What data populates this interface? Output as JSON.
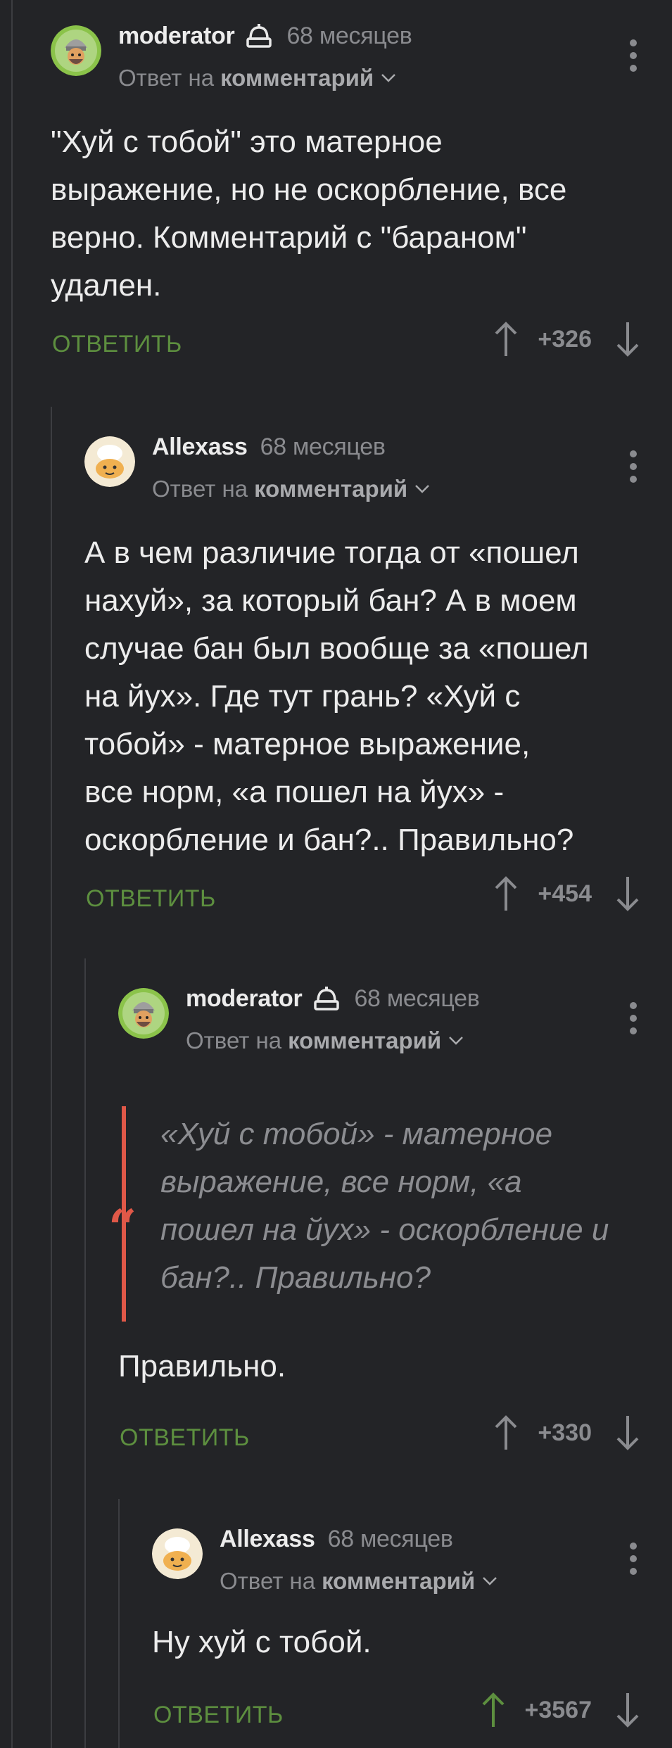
{
  "comments": [
    {
      "author": "moderator",
      "time": "68 месяцев",
      "reply_prefix": "Ответ на",
      "reply_target": "комментарий",
      "text_lines": [
        "\"Хуй с тобой\" это матерное",
        "выражение, но не оскорбление, все",
        "верно. Комментарий с \"бараном\"",
        "удален."
      ],
      "reply_label": "ОТВЕТИТЬ",
      "score": "+326"
    },
    {
      "author": "Allexass",
      "time": "68 месяцев",
      "reply_prefix": "Ответ на",
      "reply_target": "комментарий",
      "text_lines": [
        "А в чем различие тогда от «пошел",
        "нахуй», за который бан? А в моем",
        "случае бан был вообще за «пошел",
        "на йух». Где тут грань? «Хуй с",
        "тобой» - матерное выражение,",
        "все норм, «а пошел на йух» -",
        "оскорбление и бан?.. Правильно?"
      ],
      "reply_label": "ОТВЕТИТЬ",
      "score": "+454"
    },
    {
      "author": "moderator",
      "time": "68 месяцев",
      "reply_prefix": "Ответ на",
      "reply_target": "комментарий",
      "quote_lines": [
        "«Хуй с тобой» - матерное",
        "выражение, все норм, «а",
        "пошел на йух» - оскорбление и",
        "бан?.. Правильно?"
      ],
      "text_lines": [
        "Правильно."
      ],
      "reply_label": "ОТВЕТИТЬ",
      "score": "+330"
    },
    {
      "author": "Allexass",
      "time": "68 месяцев",
      "reply_prefix": "Ответ на",
      "reply_target": "комментарий",
      "text_lines": [
        "Ну хуй с тобой."
      ],
      "reply_label": "ОТВЕТИТЬ",
      "score": "+3567"
    }
  ],
  "colors": {
    "background": "#232427",
    "reply_green": "#5d8f3f",
    "quote_red": "#e05848",
    "upvote_active": "#5d8f3f"
  }
}
